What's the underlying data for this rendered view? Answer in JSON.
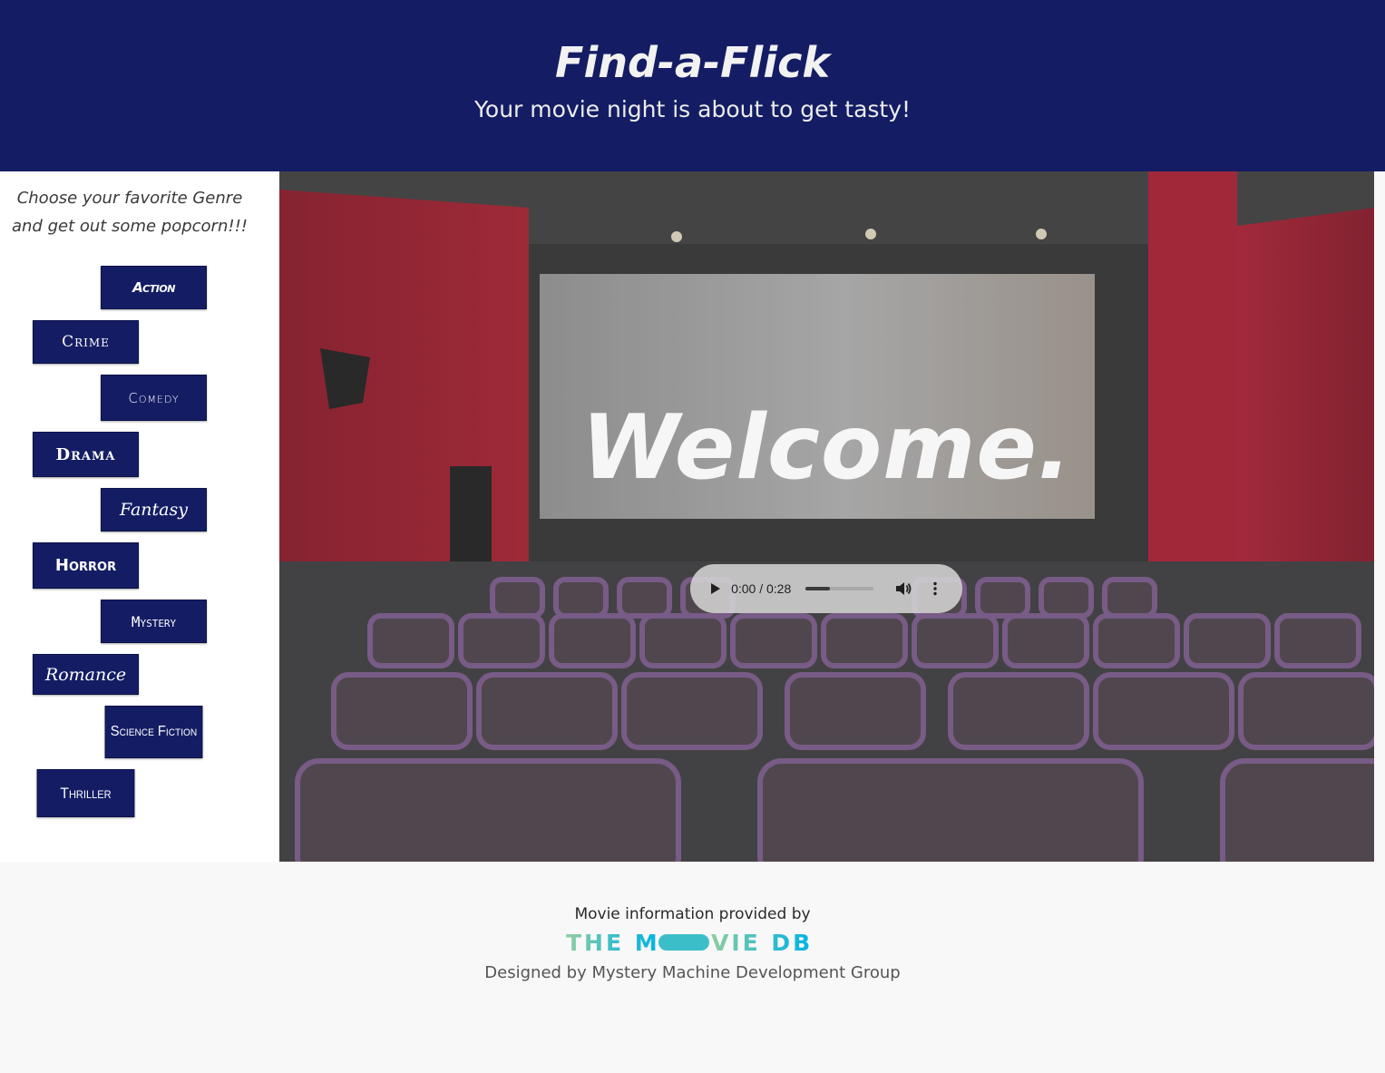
{
  "header": {
    "title": "Find-a-Flick",
    "tagline": "Your movie night is about to get tasty!",
    "background_color": "#141d64"
  },
  "sidebar": {
    "intro": "Choose your favorite Genre and get out some popcorn!!!",
    "genres": [
      {
        "label": "Action"
      },
      {
        "label": "Crime"
      },
      {
        "label": "Comedy"
      },
      {
        "label": "Drama"
      },
      {
        "label": "Fantasy"
      },
      {
        "label": "Horror"
      },
      {
        "label": "Mystery"
      },
      {
        "label": "Romance"
      },
      {
        "label": "Science Fiction"
      },
      {
        "label": "Thriller"
      }
    ],
    "button_color": "#141d64"
  },
  "hero": {
    "welcome": "Welcome.",
    "background": "cinema-theater-photo",
    "audio": {
      "time_display": "0:00 / 0:28",
      "progress_fraction": 0.0,
      "play_icon": "play-icon",
      "volume_icon": "volume-icon",
      "more_icon": "more-vertical-icon"
    }
  },
  "footer": {
    "credit": "Movie information provided by",
    "logo_text": "THE MOVIE DB",
    "designed_by": "Designed by Mystery Machine Development Group"
  }
}
